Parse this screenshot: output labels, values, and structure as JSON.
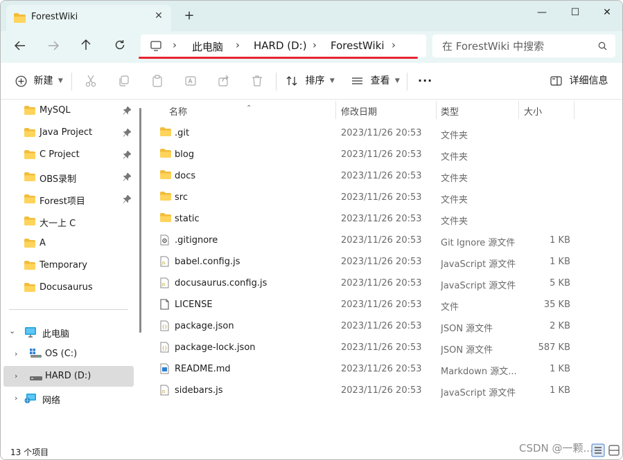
{
  "window": {
    "tab_title": "ForestWiki",
    "new_tab": "+",
    "minimize": "—",
    "maximize": "☐",
    "close": "✕",
    "tab_close": "✕"
  },
  "address": {
    "crumbs": [
      "此电脑",
      "HARD (D:)",
      "ForestWiki"
    ],
    "separator": "›",
    "search_placeholder": "在 ForestWiki 中搜索",
    "annotation_color": "#e8232f"
  },
  "toolbar": {
    "new_label": "新建",
    "sort_label": "排序",
    "view_label": "查看",
    "more_label": "···",
    "details_label": "详细信息"
  },
  "sidebar": {
    "quick_access": [
      {
        "label": "MySQL",
        "pinned": true
      },
      {
        "label": "Java Project",
        "pinned": true
      },
      {
        "label": "C Project",
        "pinned": true
      },
      {
        "label": "OBS录制",
        "pinned": true
      },
      {
        "label": "Forest项目",
        "pinned": true
      },
      {
        "label": "大一上 C",
        "pinned": false
      },
      {
        "label": "A",
        "pinned": false
      },
      {
        "label": "Temporary",
        "pinned": false
      },
      {
        "label": "Docusaurus",
        "pinned": false
      }
    ],
    "tree": [
      {
        "label": "此电脑",
        "expanded": true,
        "icon": "computer-icon"
      },
      {
        "label": "OS (C:)",
        "expanded": false,
        "icon": "windows-drive-icon"
      },
      {
        "label": "HARD (D:)",
        "expanded": false,
        "icon": "drive-icon",
        "selected": true
      },
      {
        "label": "网络",
        "expanded": false,
        "icon": "network-icon"
      }
    ]
  },
  "list": {
    "headers": {
      "name": "名称",
      "date": "修改日期",
      "type": "类型",
      "size": "大小"
    },
    "rows": [
      {
        "name": ".git",
        "date": "2023/11/26 20:53",
        "type": "文件夹",
        "size": "",
        "icon": "folder-icon"
      },
      {
        "name": "blog",
        "date": "2023/11/26 20:53",
        "type": "文件夹",
        "size": "",
        "icon": "folder-icon"
      },
      {
        "name": "docs",
        "date": "2023/11/26 20:53",
        "type": "文件夹",
        "size": "",
        "icon": "folder-icon"
      },
      {
        "name": "src",
        "date": "2023/11/26 20:53",
        "type": "文件夹",
        "size": "",
        "icon": "folder-icon"
      },
      {
        "name": "static",
        "date": "2023/11/26 20:53",
        "type": "文件夹",
        "size": "",
        "icon": "folder-icon"
      },
      {
        "name": ".gitignore",
        "date": "2023/11/26 20:53",
        "type": "Git Ignore 源文件",
        "size": "1 KB",
        "icon": "settings-file-icon"
      },
      {
        "name": "babel.config.js",
        "date": "2023/11/26 20:53",
        "type": "JavaScript 源文件",
        "size": "1 KB",
        "icon": "js-file-icon"
      },
      {
        "name": "docusaurus.config.js",
        "date": "2023/11/26 20:53",
        "type": "JavaScript 源文件",
        "size": "5 KB",
        "icon": "js-file-icon"
      },
      {
        "name": "LICENSE",
        "date": "2023/11/26 20:53",
        "type": "文件",
        "size": "35 KB",
        "icon": "file-icon"
      },
      {
        "name": "package.json",
        "date": "2023/11/26 20:53",
        "type": "JSON 源文件",
        "size": "2 KB",
        "icon": "json-file-icon"
      },
      {
        "name": "package-lock.json",
        "date": "2023/11/26 20:53",
        "type": "JSON 源文件",
        "size": "587 KB",
        "icon": "json-file-icon"
      },
      {
        "name": "README.md",
        "date": "2023/11/26 20:53",
        "type": "Markdown 源文...",
        "size": "1 KB",
        "icon": "markdown-file-icon"
      },
      {
        "name": "sidebars.js",
        "date": "2023/11/26 20:53",
        "type": "JavaScript 源文件",
        "size": "1 KB",
        "icon": "js-file-icon"
      }
    ]
  },
  "status": {
    "item_count": "13 个项目",
    "watermark": "CSDN @一颗..."
  }
}
